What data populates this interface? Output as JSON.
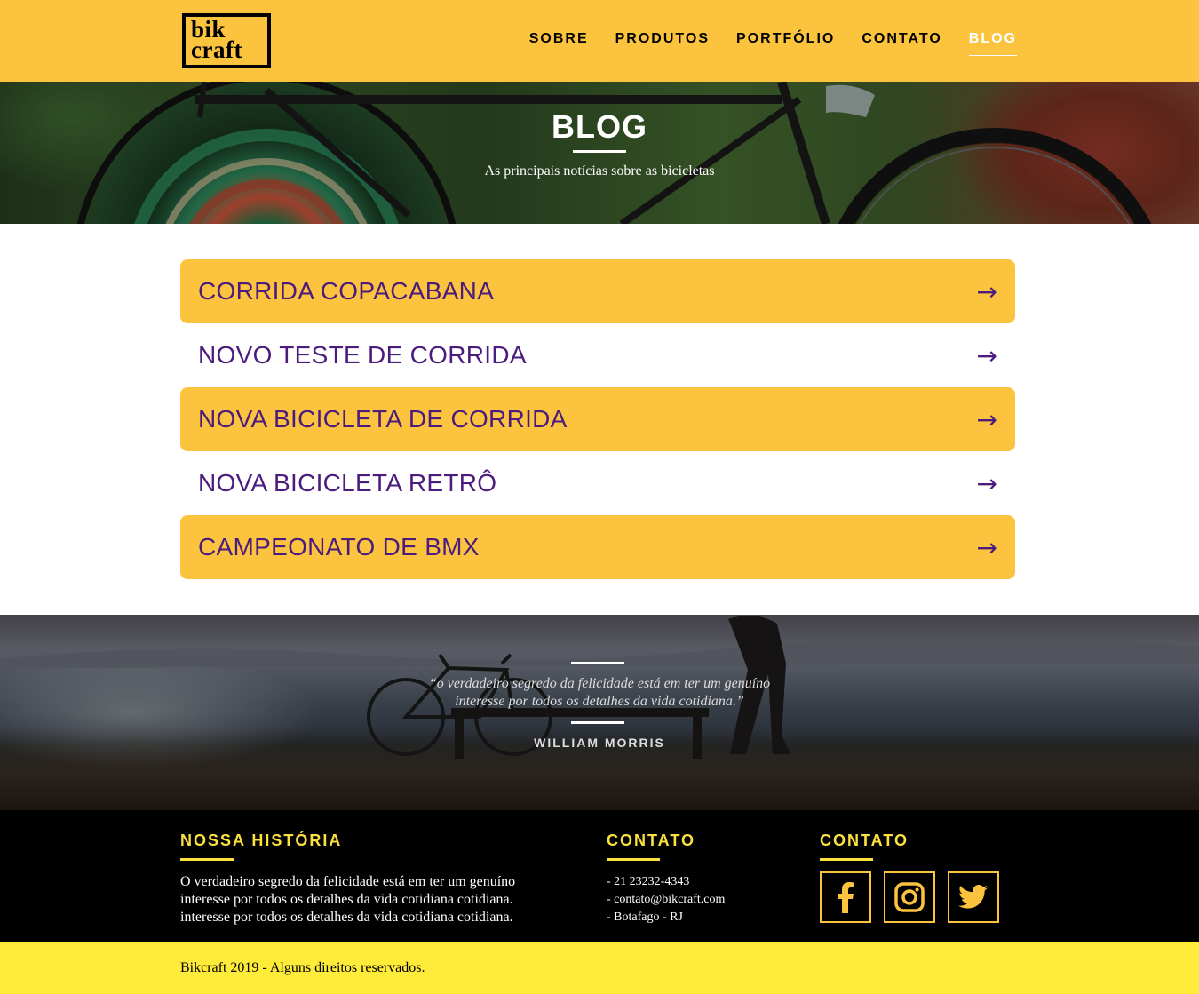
{
  "header": {
    "logo": {
      "line1": "bik",
      "line2": "craft"
    },
    "nav": [
      {
        "label": "SOBRE",
        "active": false
      },
      {
        "label": "PRODUTOS",
        "active": false
      },
      {
        "label": "PORTFÓLIO",
        "active": false
      },
      {
        "label": "CONTATO",
        "active": false
      },
      {
        "label": "BLOG",
        "active": true
      }
    ]
  },
  "hero": {
    "title": "BLOG",
    "subtitle": "As principais notícias sobre as bicicletas"
  },
  "posts": [
    {
      "title": "CORRIDA COPACABANA",
      "arrow": "→",
      "highlighted": true
    },
    {
      "title": "NOVO TESTE DE CORRIDA",
      "arrow": "→",
      "highlighted": false
    },
    {
      "title": "NOVA BICICLETA DE CORRIDA",
      "arrow": "→",
      "highlighted": true
    },
    {
      "title": "NOVA BICICLETA RETRÔ",
      "arrow": "→",
      "highlighted": false
    },
    {
      "title": "CAMPEONATO DE BMX",
      "arrow": "→",
      "highlighted": true
    }
  ],
  "quote": {
    "text": "“o verdadeiro segredo da felicidade está em ter um genuíno interesse por todos os detalhes da vida cotidiana.”",
    "author": "WILLIAM MORRIS"
  },
  "footer": {
    "history": {
      "heading": "NOSSA HISTÓRIA",
      "text": "O verdadeiro segredo da felicidade está em ter um genuíno interesse por todos os detalhes da vida cotidiana cotidiana. interesse por todos os detalhes da vida cotidiana cotidiana."
    },
    "contact": {
      "heading": "CONTATO",
      "items": [
        "- 21 23232-4343",
        "- contato@bikcraft.com",
        "- Botafago - RJ"
      ]
    },
    "social": {
      "heading": "CONTATO",
      "icons": [
        "facebook-icon",
        "instagram-icon",
        "twitter-icon"
      ]
    }
  },
  "copyright": "Bikcraft 2019 - Alguns direitos reservados.",
  "colors": {
    "brand_yellow": "#FCC43E",
    "footer_yellow": "#FEEB3A",
    "accent_yellow": "#FCE13E",
    "post_text": "#4B1C7E"
  }
}
